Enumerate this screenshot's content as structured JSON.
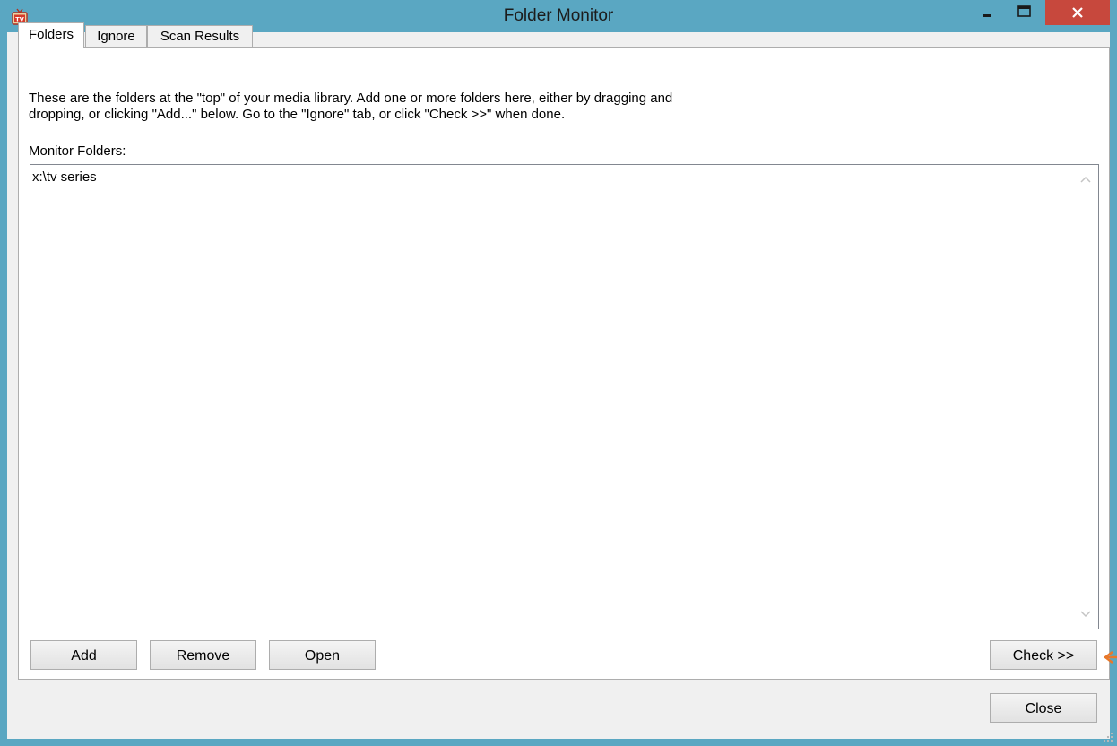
{
  "window": {
    "title": "Folder Monitor",
    "app_icon": "tv-icon",
    "controls": {
      "minimize_icon": "minimize-icon",
      "maximize_icon": "maximize-icon",
      "close_icon": "close-icon"
    }
  },
  "tabs": [
    {
      "label": "Folders",
      "active": true
    },
    {
      "label": "Ignore",
      "active": false
    },
    {
      "label": "Scan Results",
      "active": false
    }
  ],
  "folders_tab": {
    "description": "These are the folders at the \"top\" of your media library.  Add one or more folders here, either by dragging and\ndropping, or clicking \"Add...\" below.  Go to the \"Ignore\" tab, or click \"Check >>\" when done.",
    "monitor_label": "Monitor Folders:",
    "folders": [
      "x:\\tv series"
    ],
    "buttons": {
      "add": "Add",
      "remove": "Remove",
      "open": "Open",
      "check": "Check >>"
    }
  },
  "footer": {
    "close": "Close"
  },
  "colors": {
    "titlebar": "#5aa7c2",
    "close_button": "#c7483d",
    "marker": "#e8782a"
  }
}
